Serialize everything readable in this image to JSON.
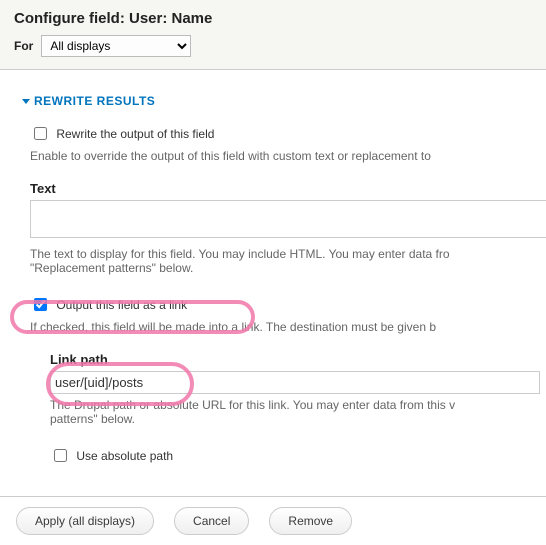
{
  "header": {
    "title": "Configure field: User: Name",
    "for_label": "For",
    "for_selected": "All displays"
  },
  "rewrite": {
    "fieldset_title": "REWRITE RESULTS",
    "rewrite_output": {
      "checked": false,
      "label": "Rewrite the output of this field",
      "desc": "Enable to override the output of this field with custom text or replacement to",
      "text_label": "Text",
      "text_value": "",
      "text_desc": "The text to display for this field. You may include HTML. You may enter data fro",
      "text_desc2": "\"Replacement patterns\" below."
    },
    "output_as_link": {
      "checked": true,
      "label": "Output this field as a link",
      "desc": "If checked, this field will be made into a link. The destination must be given b",
      "link_path_label": "Link path",
      "link_path_value": "user/[uid]/posts",
      "link_path_desc": "The Drupal path or absolute URL for this link. You may enter data from this v",
      "link_path_desc2": "patterns\" below.",
      "use_absolute": {
        "checked": false,
        "label": "Use absolute path"
      }
    }
  },
  "footer": {
    "apply": "Apply (all displays)",
    "cancel": "Cancel",
    "remove": "Remove"
  }
}
